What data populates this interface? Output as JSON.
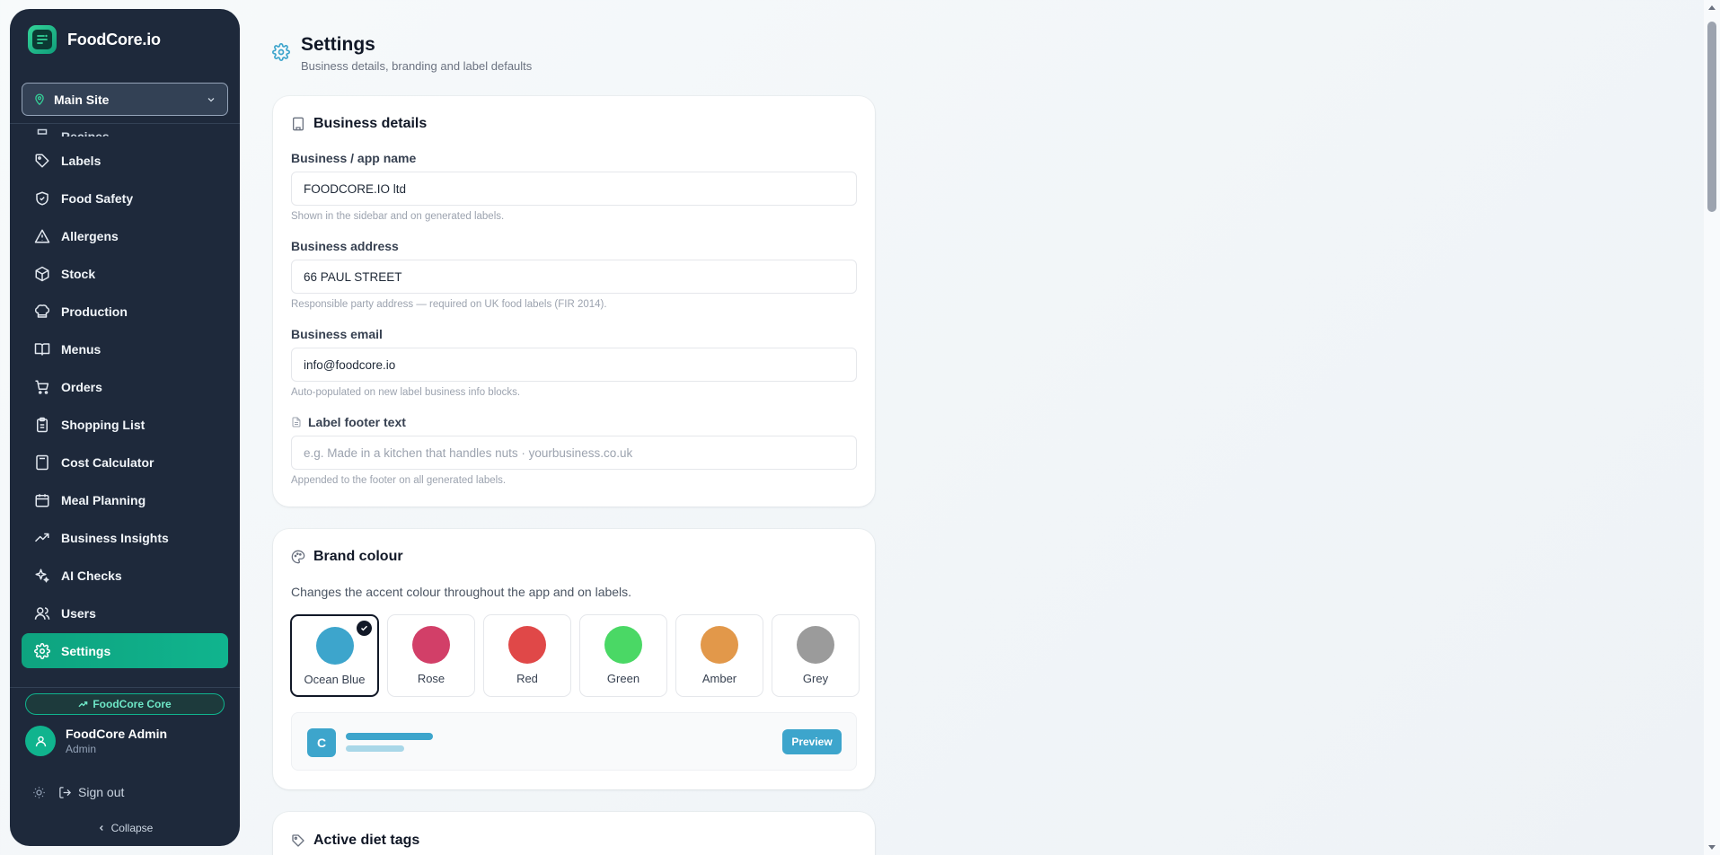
{
  "app": {
    "name": "FoodCore.io"
  },
  "site_selector": {
    "label": "Main Site"
  },
  "sidebar": {
    "partial_item": "Recipes",
    "items": [
      {
        "id": "labels",
        "label": "Labels",
        "icon": "tag-icon"
      },
      {
        "id": "food-safety",
        "label": "Food Safety",
        "icon": "shield-icon"
      },
      {
        "id": "allergens",
        "label": "Allergens",
        "icon": "warning-triangle-icon"
      },
      {
        "id": "stock",
        "label": "Stock",
        "icon": "box-icon"
      },
      {
        "id": "production",
        "label": "Production",
        "icon": "chef-hat-icon"
      },
      {
        "id": "menus",
        "label": "Menus",
        "icon": "open-book-icon"
      },
      {
        "id": "orders",
        "label": "Orders",
        "icon": "cart-icon"
      },
      {
        "id": "shopping-list",
        "label": "Shopping List",
        "icon": "clipboard-icon"
      },
      {
        "id": "cost-calculator",
        "label": "Cost Calculator",
        "icon": "calculator-icon"
      },
      {
        "id": "meal-planning",
        "label": "Meal Planning",
        "icon": "calendar-icon"
      },
      {
        "id": "business-insights",
        "label": "Business Insights",
        "icon": "trending-up-icon"
      },
      {
        "id": "ai-checks",
        "label": "AI Checks",
        "icon": "sparkles-icon"
      },
      {
        "id": "users",
        "label": "Users",
        "icon": "users-icon"
      },
      {
        "id": "settings",
        "label": "Settings",
        "icon": "gear-icon",
        "active": true
      }
    ],
    "plan_badge": "FoodCore Core",
    "user": {
      "name": "FoodCore Admin",
      "role": "Admin"
    },
    "sign_out": "Sign out",
    "collapse": "Collapse"
  },
  "page": {
    "title": "Settings",
    "subtitle": "Business details, branding and label defaults"
  },
  "business_details": {
    "title": "Business details",
    "name_label": "Business / app name",
    "name_value": "FOODCORE.IO ltd",
    "name_help": "Shown in the sidebar and on generated labels.",
    "address_label": "Business address",
    "address_value": "66 PAUL STREET",
    "address_help": "Responsible party address — required on UK food labels (FIR 2014).",
    "email_label": "Business email",
    "email_value": "info@foodcore.io",
    "email_help": "Auto-populated on new label business info blocks.",
    "footer_label": "Label footer text",
    "footer_placeholder": "e.g. Made in a kitchen that handles nuts · yourbusiness.co.uk",
    "footer_help": "Appended to the footer on all generated labels."
  },
  "brand_colour": {
    "title": "Brand colour",
    "description": "Changes the accent colour throughout the app and on labels.",
    "selected": "Ocean Blue",
    "options": [
      {
        "name": "Ocean Blue",
        "color": "#3da5cc"
      },
      {
        "name": "Rose",
        "color": "#d23f68"
      },
      {
        "name": "Red",
        "color": "#e04848"
      },
      {
        "name": "Green",
        "color": "#4ad865"
      },
      {
        "name": "Amber",
        "color": "#e2984a"
      },
      {
        "name": "Grey",
        "color": "#9b9b9b"
      }
    ],
    "preview_badge": "C",
    "preview_button": "Preview"
  },
  "diet_tags": {
    "title": "Active diet tags"
  },
  "colors": {
    "sidebar_bg": "#1e293b",
    "accent_green": "#10b48e",
    "brand_blue": "#3da5cc"
  }
}
